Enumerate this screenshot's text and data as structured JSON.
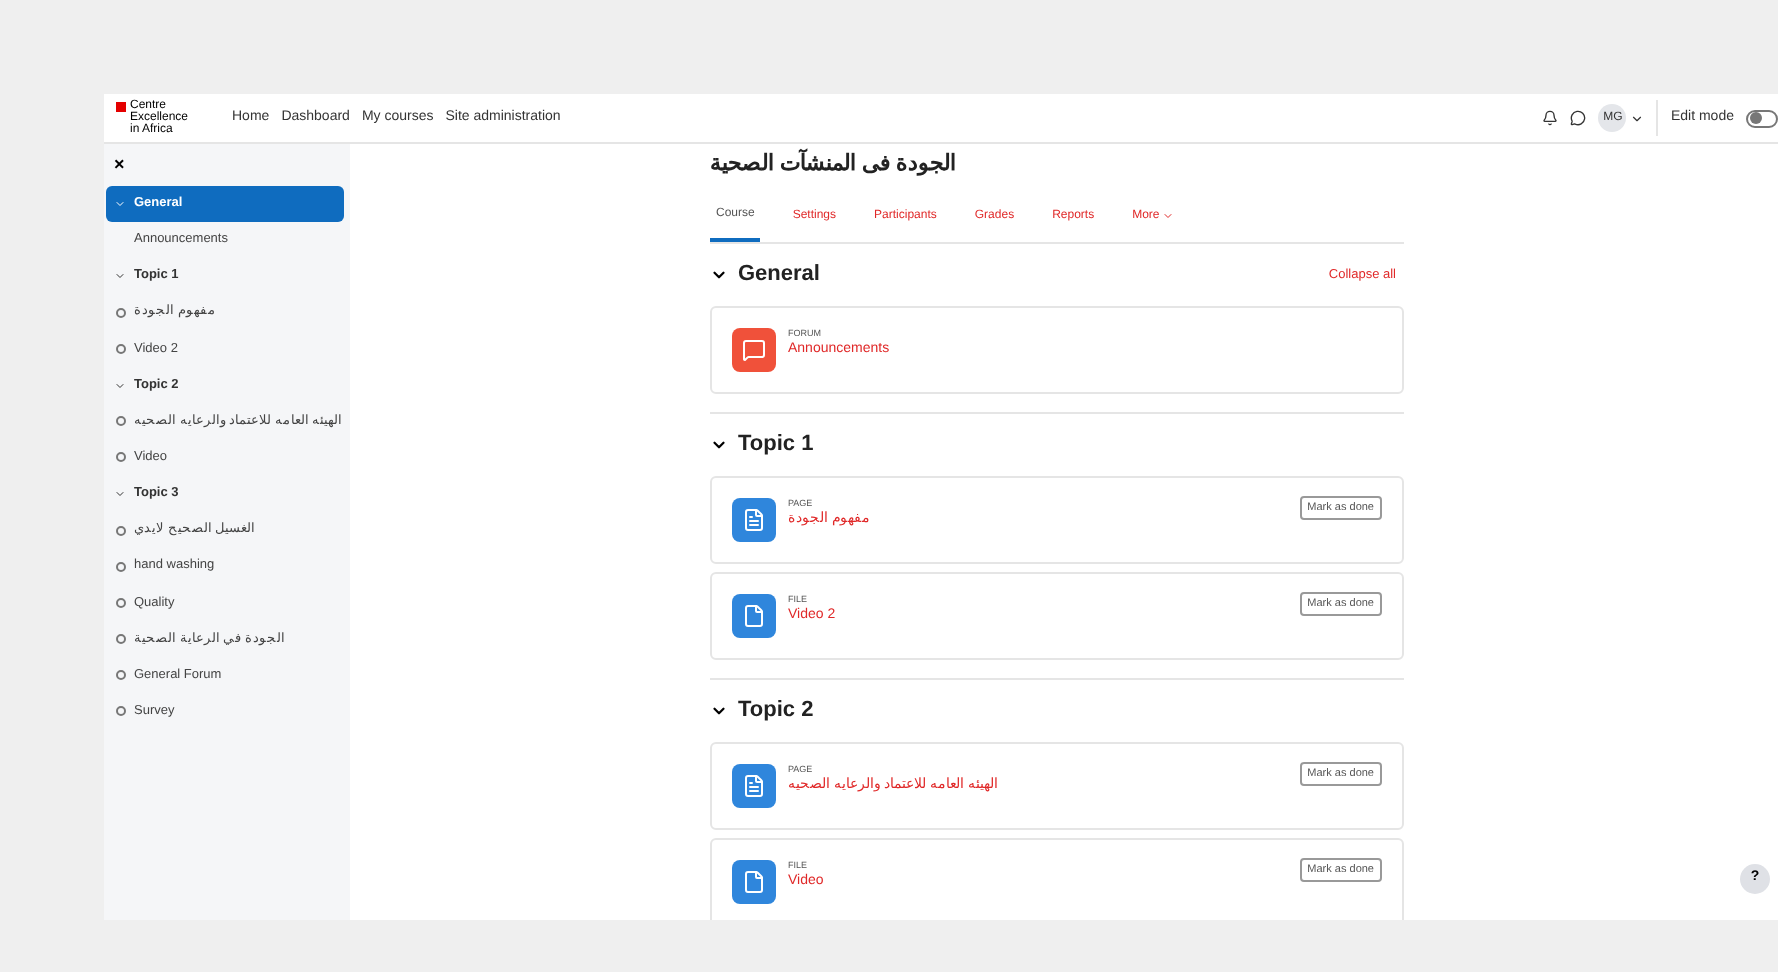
{
  "navbar": {
    "logo": [
      "Centre",
      "Excellence",
      "in Africa"
    ],
    "links": [
      "Home",
      "Dashboard",
      "My courses",
      "Site administration"
    ],
    "user_initials": "MG",
    "edit_mode": {
      "label": "Edit mode",
      "on": false
    }
  },
  "sidebar": {
    "close": "×",
    "items": [
      {
        "label": "General",
        "selected": true,
        "expanded": true,
        "children": [
          {
            "label": "Announcements",
            "marker": false
          }
        ]
      },
      {
        "label": "Topic 1",
        "selected": false,
        "expanded": true,
        "children": [
          {
            "label": "مفهوم الجودة",
            "marker": true
          },
          {
            "label": "Video 2",
            "marker": true
          }
        ]
      },
      {
        "label": "Topic 2",
        "selected": false,
        "expanded": true,
        "children": [
          {
            "label": "الهيئه العامه للاعتماد والرعايه الصحيه",
            "marker": true
          },
          {
            "label": "Video",
            "marker": true
          }
        ]
      },
      {
        "label": "Topic 3",
        "selected": false,
        "expanded": true,
        "children": [
          {
            "label": "الغسيل الصحيح لايدي",
            "marker": true
          },
          {
            "label": "hand washing",
            "marker": true
          },
          {
            "label": "Quality",
            "marker": true
          },
          {
            "label": "الجودة في الرعاية الصحية",
            "marker": true
          },
          {
            "label": "General Forum",
            "marker": true
          },
          {
            "label": "Survey",
            "marker": true
          }
        ]
      }
    ]
  },
  "course": {
    "title": "الجودة فى المنشآت الصحية",
    "tabs": [
      {
        "label": "Course",
        "selected": true
      },
      {
        "label": "Settings",
        "selected": false
      },
      {
        "label": "Participants",
        "selected": false
      },
      {
        "label": "Grades",
        "selected": false
      },
      {
        "label": "Reports",
        "selected": false
      },
      {
        "label": "More",
        "selected": false
      }
    ],
    "collapse_all": "Collapse all",
    "sections": [
      {
        "title": "General",
        "activities": [
          {
            "kind": "forum",
            "type": "FORUM",
            "name": "Announcements"
          }
        ]
      },
      {
        "title": "Topic 1",
        "activities": [
          {
            "kind": "page",
            "type": "PAGE",
            "name": "مفهوم الجودة",
            "button": "Mark as done"
          },
          {
            "kind": "file",
            "type": "FILE",
            "name": "Video 2",
            "button": "Mark as done"
          }
        ]
      },
      {
        "title": "Topic 2",
        "activities": [
          {
            "kind": "page",
            "type": "PAGE",
            "name": "الهيئه العامه للاعتماد والرعايه الصحيه",
            "button": "Mark as done"
          },
          {
            "kind": "file",
            "type": "FILE",
            "name": "Video",
            "button": "Mark as done"
          }
        ]
      }
    ]
  },
  "help": "?"
}
